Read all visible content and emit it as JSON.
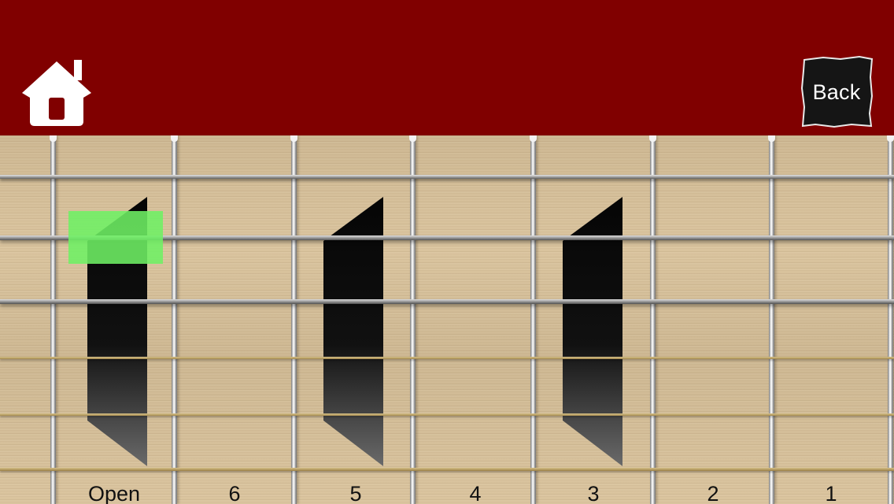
{
  "header": {
    "home_icon": "home-icon",
    "back_label": "Back",
    "background_color": "#800000"
  },
  "fretboard": {
    "fret_labels": [
      "Open",
      "6",
      "5",
      "4",
      "3",
      "2",
      "1"
    ],
    "inlay_positions": [
      "Open",
      "5",
      "3"
    ],
    "strings": 6,
    "highlighted_note": {
      "string": 2,
      "fret": "Open"
    },
    "highlight_color": "#6ef064"
  }
}
